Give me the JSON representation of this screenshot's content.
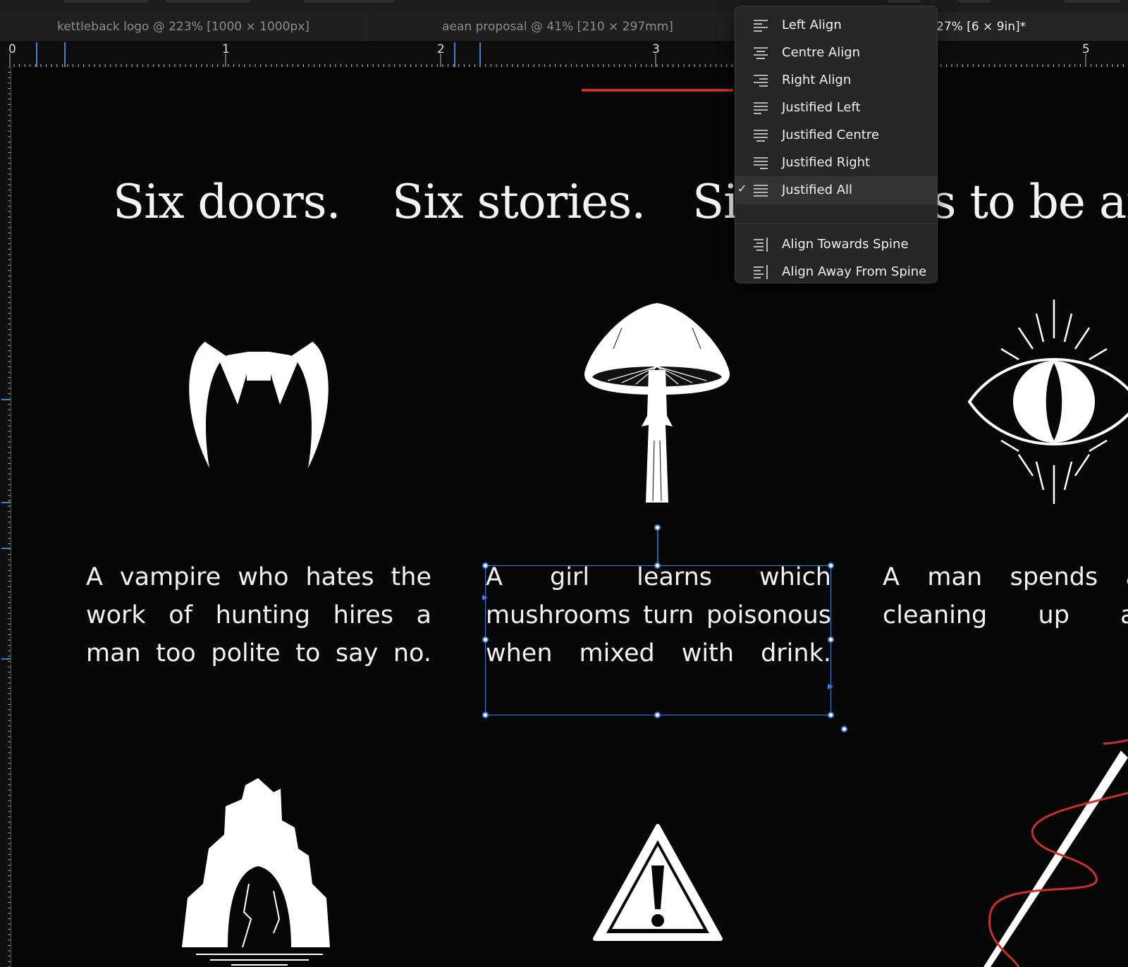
{
  "tabs": [
    {
      "label": "kettleback logo @ 223% [1000 × 1000px]"
    },
    {
      "label": "aean proposal @ 41% [210 × 297mm]"
    },
    {
      "label": "27% [6 × 9in]*"
    }
  ],
  "ruler": {
    "marks": [
      "0",
      "1",
      "2",
      "3",
      "5"
    ]
  },
  "colors": {
    "canvas": "#070707",
    "accent_red": "#c8302c",
    "selection_blue": "#3f7fdc"
  },
  "document": {
    "headlines": [
      "Six doors.",
      "Six stories.",
      "Six reasons to be afr"
    ],
    "descriptions": [
      "A vampire who hates the work of hunting hires a man too polite to say no.",
      "A girl learns which mushrooms turn poisonous when mixed with drink.",
      "A man spends a r cleaning up after"
    ],
    "icons": [
      "vampire-fangs",
      "mushroom",
      "eye",
      "cave",
      "warning-sign",
      "needle-and-thread"
    ]
  },
  "align_menu": {
    "items": [
      {
        "label": "Left Align",
        "icon": "left-align-icon",
        "checked": false
      },
      {
        "label": "Centre Align",
        "icon": "centre-align-icon",
        "checked": false
      },
      {
        "label": "Right Align",
        "icon": "right-align-icon",
        "checked": false
      },
      {
        "label": "Justified Left",
        "icon": "justified-left-icon",
        "checked": false
      },
      {
        "label": "Justified Centre",
        "icon": "justified-centre-icon",
        "checked": false
      },
      {
        "label": "Justified Right",
        "icon": "justified-right-icon",
        "checked": false
      },
      {
        "label": "Justified All",
        "icon": "justified-all-icon",
        "checked": true
      },
      {
        "label": "Align Towards Spine",
        "icon": "align-towards-spine-icon",
        "checked": false
      },
      {
        "label": "Align Away From Spine",
        "icon": "align-away-from-spine-icon",
        "checked": false
      }
    ],
    "check_glyph": "✓"
  }
}
